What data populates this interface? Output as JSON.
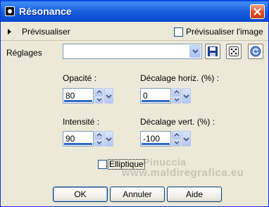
{
  "window": {
    "title": "Résonance"
  },
  "preview": {
    "label": "Prévisualiser",
    "image_preview_label": "Prévisualiser l'image",
    "image_preview_checked": false
  },
  "settings": {
    "label": "Réglages",
    "value": ""
  },
  "fields": {
    "opacity": {
      "label": "Opacité :",
      "value": "80"
    },
    "h_offset": {
      "label": "Décalage horiz. (%) :",
      "value": "0"
    },
    "intensity": {
      "label": "Intensité :",
      "value": "90"
    },
    "v_offset": {
      "label": "Décalage vert. (%) :",
      "value": "-100"
    }
  },
  "elliptique": {
    "label": "Elliptique",
    "checked": false
  },
  "watermark": {
    "line1": "Pinuccia",
    "line2": "www.maldiregrafica.eu"
  },
  "buttons": {
    "ok": "OK",
    "cancel": "Annuler",
    "help": "Aide"
  },
  "icons": {
    "app": "app-icon",
    "close": "close-icon",
    "expand": "triangle-right-icon",
    "save": "save-icon",
    "random": "dice-icon",
    "reset": "reset-icon"
  },
  "colors": {
    "titlebar": "#0a4fd6",
    "dialog": "#ece9d8",
    "accent": "#316ac5"
  }
}
